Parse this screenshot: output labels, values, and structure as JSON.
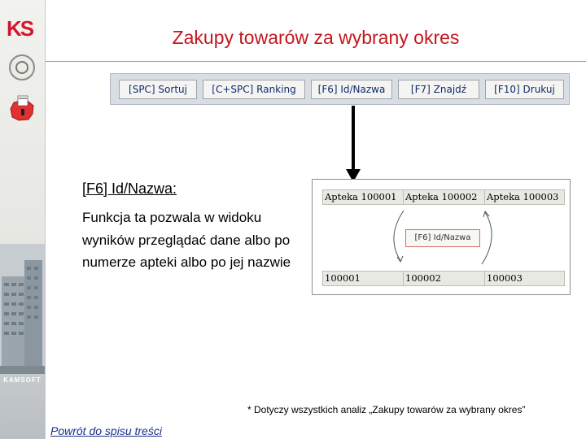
{
  "slide": {
    "title": "Zakupy towarów za wybrany okres",
    "heading": "[F6] Id/Nazwa:",
    "description": "Funkcja ta pozwala w widoku wyników przeglądać dane albo po numerze apteki albo po jej nazwie",
    "footnote": "* Dotyczy wszystkich analiz „Zakupy towarów za wybrany okres”",
    "back_link": "Powrót do spisu treści"
  },
  "sidebar": {
    "logo_text": "KS",
    "footer_text": "KAMSOFT"
  },
  "toolbar": {
    "buttons": [
      {
        "label": "[SPC] Sortuj"
      },
      {
        "label": "[C+SPC] Ranking"
      },
      {
        "label": "[F6] Id/Nazwa"
      },
      {
        "label": "[F7] Znajdź"
      },
      {
        "label": "[F10] Drukuj"
      }
    ]
  },
  "demo": {
    "names_row": [
      "Apteka 100001",
      "Apteka 100002",
      "Apteka 100003"
    ],
    "ids_row": [
      "100001",
      "100002",
      "100003"
    ],
    "button_label": "[F6] Id/Nazwa"
  },
  "colors": {
    "title": "#c2181e",
    "link": "#1a2f8c",
    "brand": "#d3172e"
  }
}
